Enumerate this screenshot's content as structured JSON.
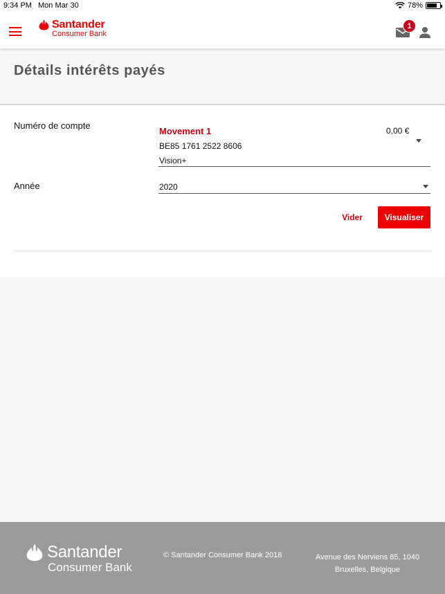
{
  "status_bar": {
    "time": "9:34 PM",
    "date": "Mon Mar 30",
    "battery": "78%",
    "battery_level": 0.78,
    "icons": [
      "wifi-icon",
      "battery-icon"
    ]
  },
  "header": {
    "menu_icon": "hamburger-menu-icon",
    "logo": {
      "brand": "Santander",
      "sub": "Consumer Bank"
    },
    "mail_icon": "envelope-icon",
    "mail_badge": "1",
    "user_icon": "user-icon"
  },
  "page": {
    "title": "Détails intérêts payés"
  },
  "form": {
    "account_label": "Numéro de compte",
    "account": {
      "name": "Movement 1",
      "number": "BE85 1761 2522 8606",
      "product": "Vision+",
      "balance": "0,00 €"
    },
    "year_label": "Année",
    "year_value": "2020",
    "clear_label": "Vider",
    "view_label": "Visualiser"
  },
  "footer": {
    "logo": {
      "brand": "Santander",
      "sub": "Consumer Bank"
    },
    "copyright": "© Santander Consumer Bank 2018",
    "address_line1": "Avenue des Nerviens 85, 1040",
    "address_line2": "Bruxelles, Belgique"
  },
  "colors": {
    "brand_red": "#ec0000",
    "badge_red": "#c9001b",
    "footer_gray": "#9b9b9b"
  }
}
